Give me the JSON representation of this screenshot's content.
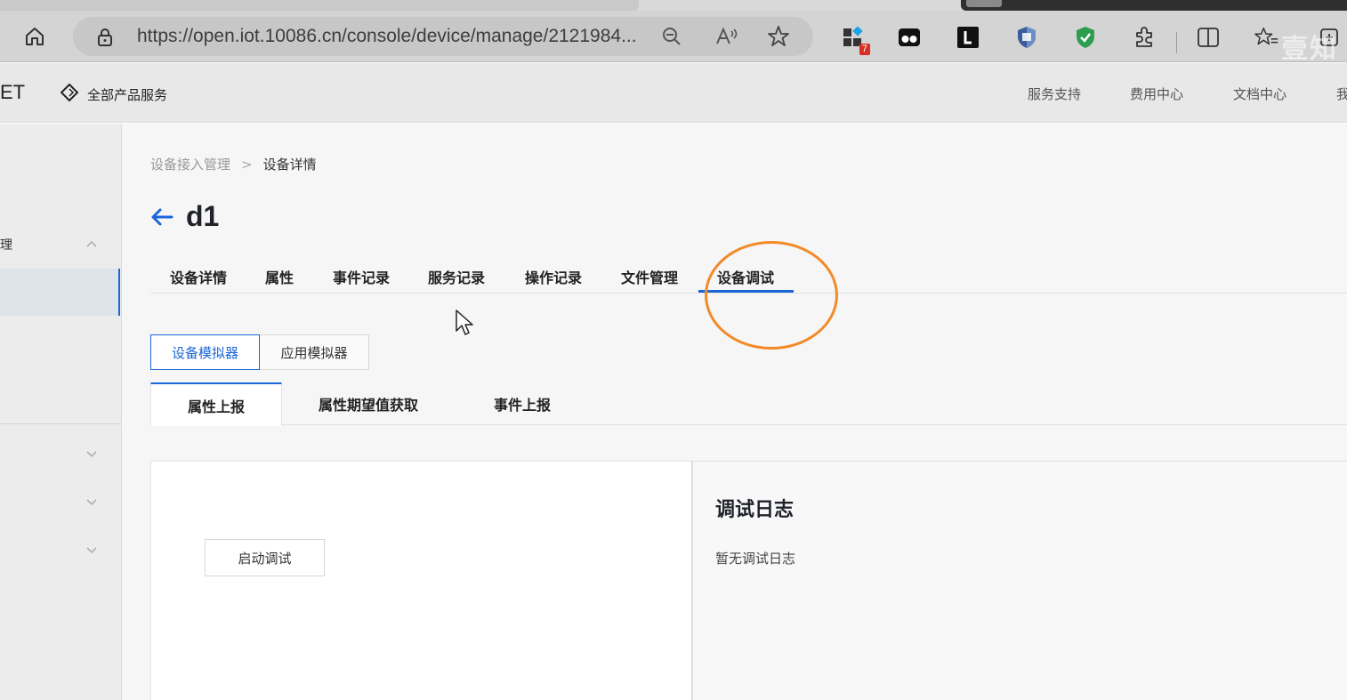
{
  "browser": {
    "url": "https://open.iot.10086.cn/console/device/manage/2121984...",
    "extension_badge": "7",
    "watermark": "壹知"
  },
  "site": {
    "logo_fragment": "ET",
    "all_products": "全部产品服务",
    "nav": [
      "服务支持",
      "费用中心",
      "文档中心",
      "我"
    ]
  },
  "sidebar": {
    "group_label": "理"
  },
  "breadcrumb": {
    "parent": "设备接入管理",
    "separator": ">",
    "current": "设备详情"
  },
  "page": {
    "title": "d1"
  },
  "tabs": [
    "设备详情",
    "属性",
    "事件记录",
    "服务记录",
    "操作记录",
    "文件管理",
    "设备调试"
  ],
  "active_tab": "设备调试",
  "simulator": {
    "options": [
      "设备模拟器",
      "应用模拟器"
    ],
    "selected": "设备模拟器"
  },
  "subtabs": [
    "属性上报",
    "属性期望值获取",
    "事件上报"
  ],
  "active_subtab": "属性上报",
  "debug": {
    "start_button": "启动调试",
    "log_title": "调试日志",
    "log_empty": "暂无调试日志"
  },
  "colors": {
    "accent": "#1a66d9",
    "highlight": "#f28a28"
  }
}
